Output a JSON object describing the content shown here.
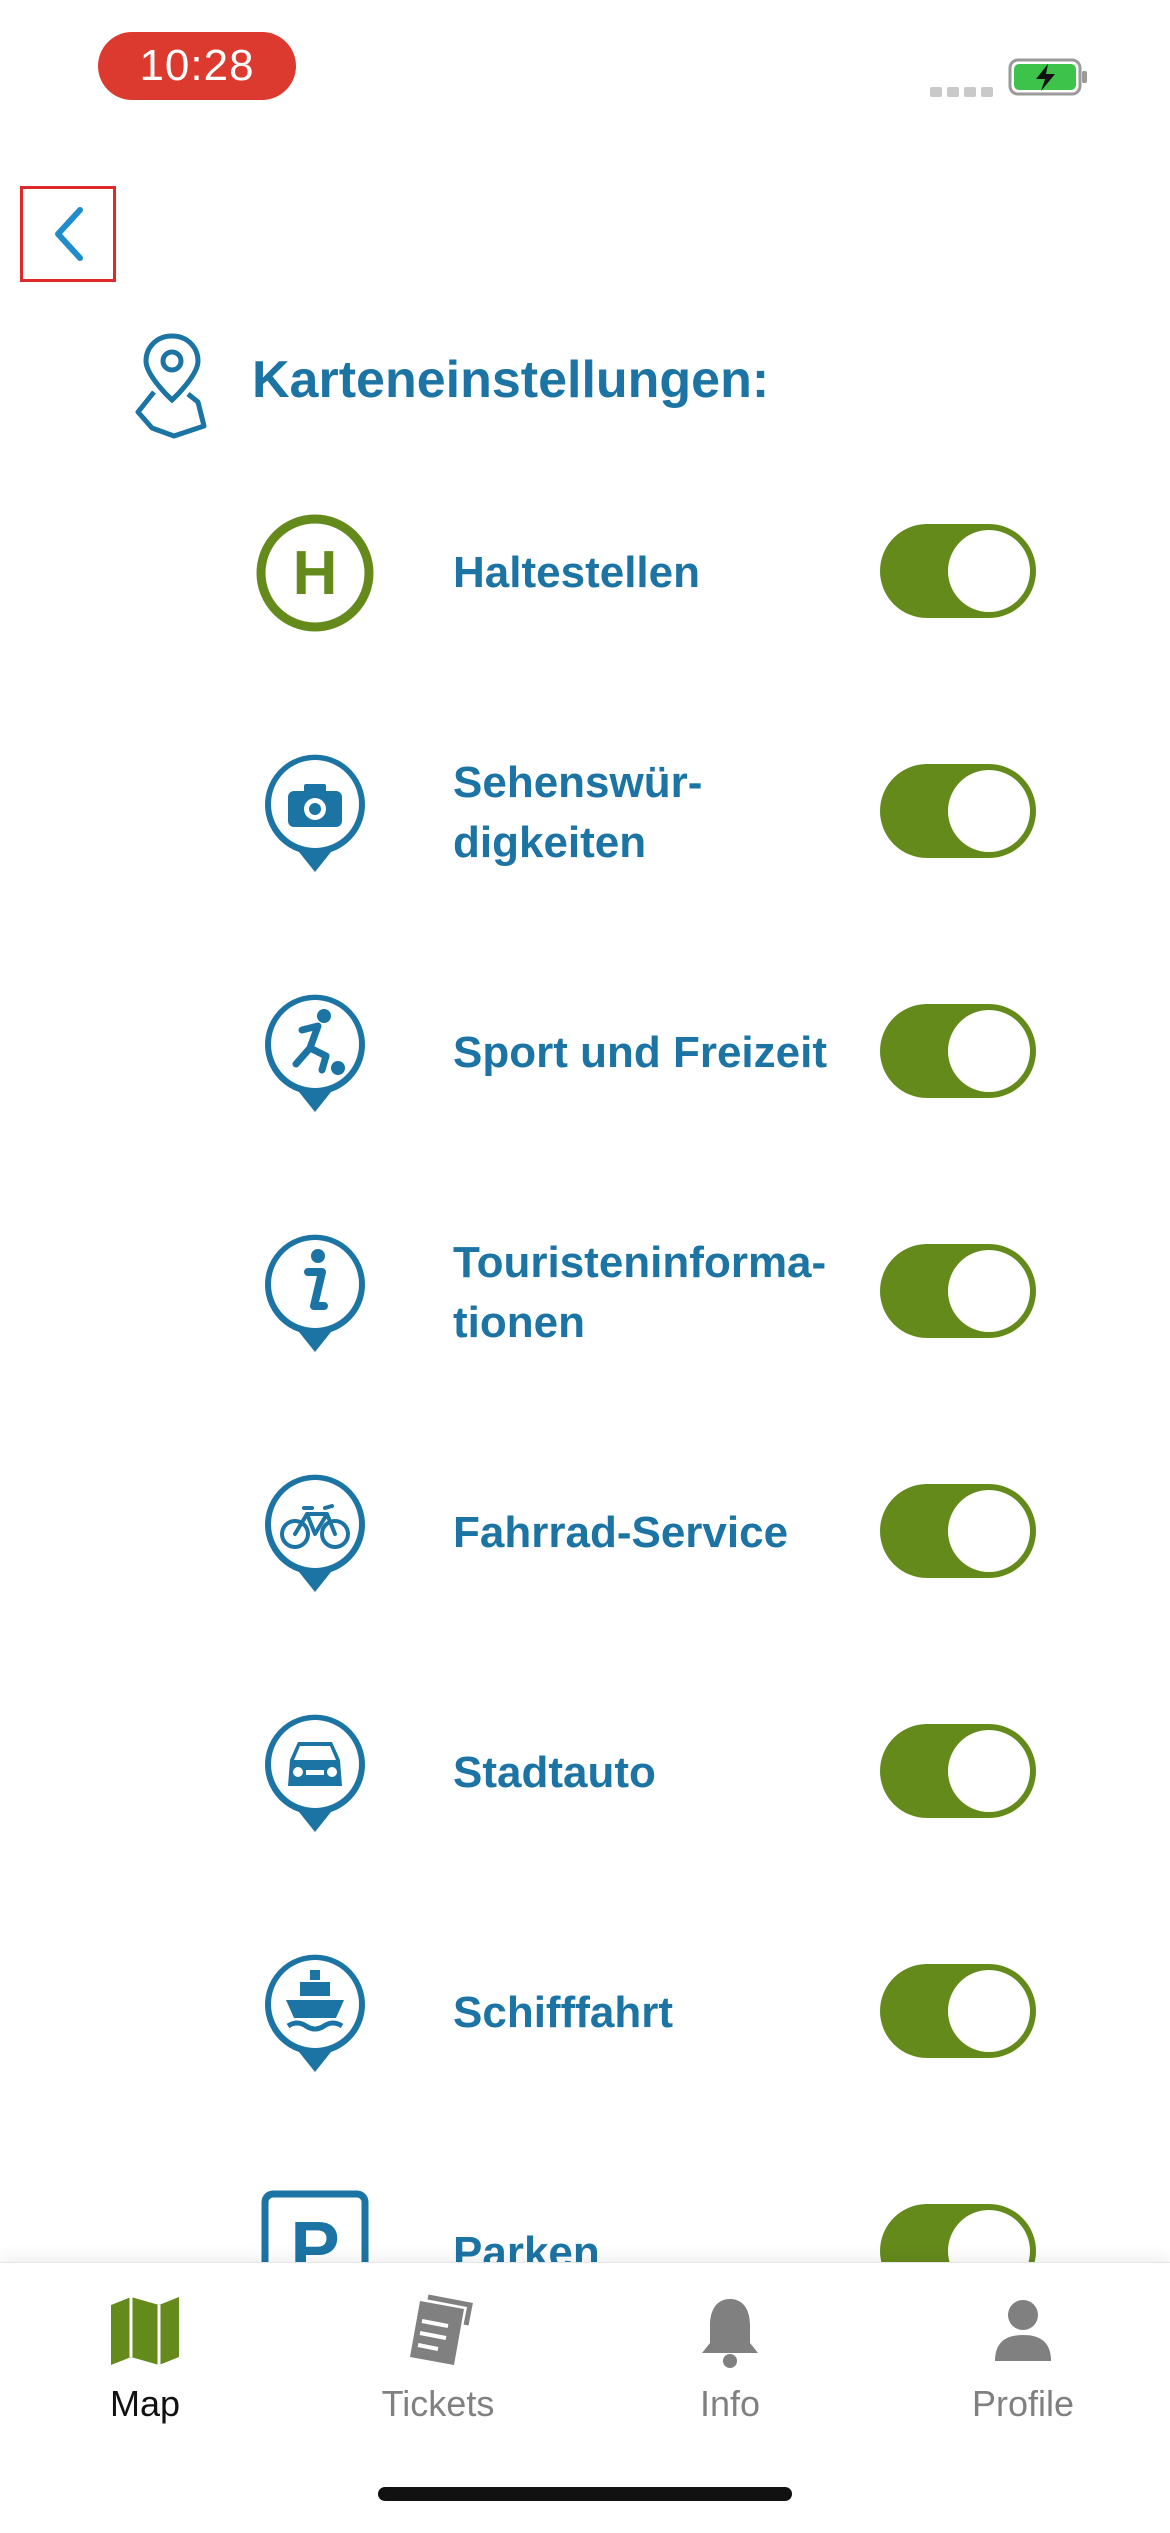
{
  "status_bar": {
    "time": "10:28"
  },
  "header": {
    "title": "Karteneinstellungen:"
  },
  "settings": [
    {
      "label": "Haltestellen",
      "icon": "bus-stop-icon",
      "enabled": true
    },
    {
      "label": "Sehenswür-\ndigkeiten",
      "icon": "camera-icon",
      "enabled": true
    },
    {
      "label": "Sport und Freizeit",
      "icon": "sport-icon",
      "enabled": true
    },
    {
      "label": "Touristeninforma-\ntionen",
      "icon": "info-icon",
      "enabled": true
    },
    {
      "label": "Fahrrad-Service",
      "icon": "bicycle-icon",
      "enabled": true
    },
    {
      "label": "Stadtauto",
      "icon": "car-icon",
      "enabled": true
    },
    {
      "label": "Schifffahrt",
      "icon": "ship-icon",
      "enabled": true
    },
    {
      "label": "Parken",
      "icon": "parking-icon",
      "enabled": true
    }
  ],
  "tabs": [
    {
      "label": "Map",
      "icon": "map-icon",
      "active": true
    },
    {
      "label": "Tickets",
      "icon": "tickets-icon",
      "active": false
    },
    {
      "label": "Info",
      "icon": "bell-icon",
      "active": false
    },
    {
      "label": "Profile",
      "icon": "profile-icon",
      "active": false
    }
  ],
  "colors": {
    "primary": "#1b74a4",
    "accent_green": "#658a1c",
    "status_red": "#dc3a2f",
    "tab_inactive": "#808080",
    "tab_active_label": "#111111"
  }
}
